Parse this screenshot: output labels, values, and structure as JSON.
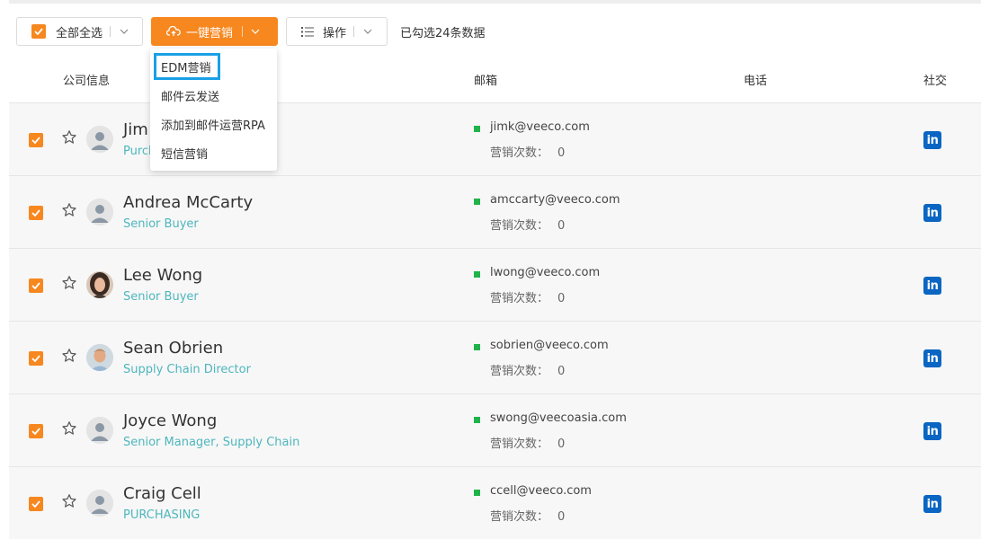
{
  "toolbar": {
    "select_all_label": "全部全选",
    "market_label": "一键营销",
    "ops_label": "操作",
    "selection_info": "已勾选24条数据"
  },
  "dropdown": {
    "items": [
      "EDM营销",
      "邮件云发送",
      "添加到邮件运营RPA",
      "短信营销"
    ]
  },
  "headers": {
    "company": "公司信息",
    "email": "邮箱",
    "phone": "电话",
    "social": "社交"
  },
  "count_label": "营销次数：",
  "linkedin_text": "in",
  "colors": {
    "accent": "#f7871f",
    "title": "#4eb6bd",
    "email_dot": "#1fb34a",
    "linkedin": "#0a66c2",
    "highlight": "#1aa0e6"
  },
  "rows": [
    {
      "name": "Jim",
      "title": "Purch",
      "email": "jimk@veeco.com",
      "count": "0",
      "avatar": "placeholder",
      "checked": true
    },
    {
      "name": "Andrea McCarty",
      "title": "Senior Buyer",
      "email": "amccarty@veeco.com",
      "count": "0",
      "avatar": "placeholder",
      "checked": true
    },
    {
      "name": "Lee Wong",
      "title": "Senior Buyer",
      "email": "lwong@veeco.com",
      "count": "0",
      "avatar": "photo-woman",
      "checked": true
    },
    {
      "name": "Sean Obrien",
      "title": "Supply Chain Director",
      "email": "sobrien@veeco.com",
      "count": "0",
      "avatar": "photo-man",
      "checked": true
    },
    {
      "name": "Joyce Wong",
      "title": "Senior Manager, Supply Chain",
      "email": "swong@veecoasia.com",
      "count": "0",
      "avatar": "placeholder",
      "checked": true
    },
    {
      "name": "Craig Cell",
      "title": "PURCHASING",
      "email": "ccell@veeco.com",
      "count": "0",
      "avatar": "placeholder",
      "checked": true
    }
  ]
}
